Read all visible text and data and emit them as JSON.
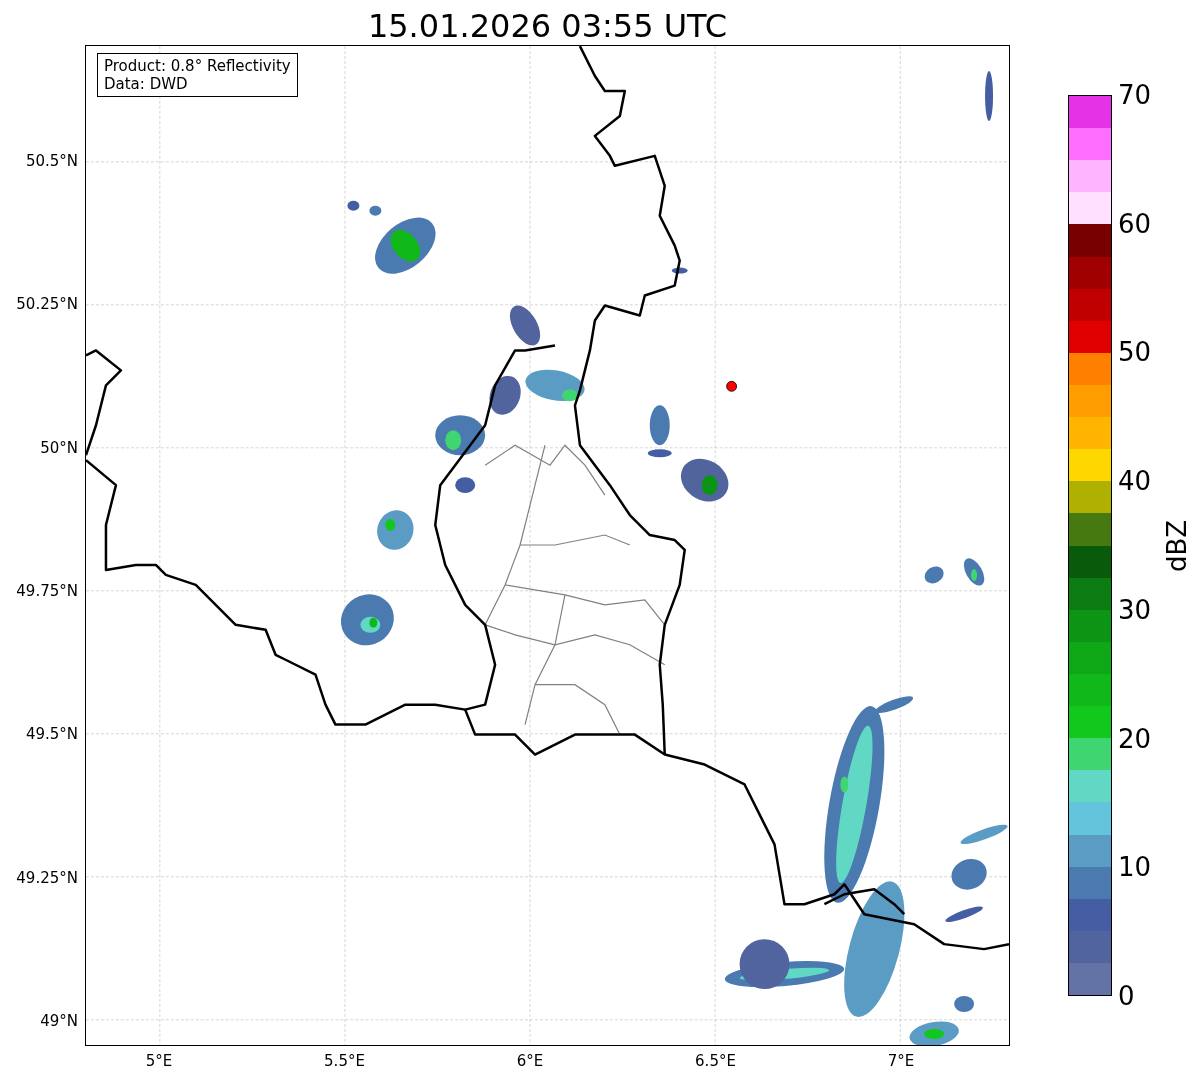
{
  "title": "15.01.2026 03:55 UTC",
  "info_box": {
    "lines": [
      "Product: 0.8° Reflectivity",
      "Data: DWD"
    ]
  },
  "map": {
    "y_ticks": [
      "50.5°N",
      "50.25°N",
      "50°N",
      "49.75°N",
      "49.5°N",
      "49.25°N",
      "49°N"
    ],
    "x_ticks": [
      "5°E",
      "5.5°E",
      "6°E",
      "6.5°E",
      "7°E"
    ]
  },
  "colorbar": {
    "label": "dBZ",
    "ticks": [
      "70",
      "60",
      "50",
      "40",
      "30",
      "20",
      "10",
      "0"
    ],
    "segments": [
      {
        "color": "#e632e6"
      },
      {
        "color": "#ff6eff"
      },
      {
        "color": "#ffb4ff"
      },
      {
        "color": "#ffe0ff"
      },
      {
        "color": "#780000"
      },
      {
        "color": "#a00000"
      },
      {
        "color": "#c00000"
      },
      {
        "color": "#e00000"
      },
      {
        "color": "#ff8000"
      },
      {
        "color": "#ff9c00"
      },
      {
        "color": "#ffb400"
      },
      {
        "color": "#ffd700"
      },
      {
        "color": "#b0b000"
      },
      {
        "color": "#467a10"
      },
      {
        "color": "#0a5a0c"
      },
      {
        "color": "#0a7c12"
      },
      {
        "color": "#0c9414"
      },
      {
        "color": "#0ea816"
      },
      {
        "color": "#10b81a"
      },
      {
        "color": "#12c81c"
      },
      {
        "color": "#3fd672"
      },
      {
        "color": "#60d8c4"
      },
      {
        "color": "#64c4dc"
      },
      {
        "color": "#5a9cc4"
      },
      {
        "color": "#4a7ab0"
      },
      {
        "color": "#445da3"
      },
      {
        "color": "#52649e"
      },
      {
        "color": "#6473a6"
      }
    ]
  }
}
